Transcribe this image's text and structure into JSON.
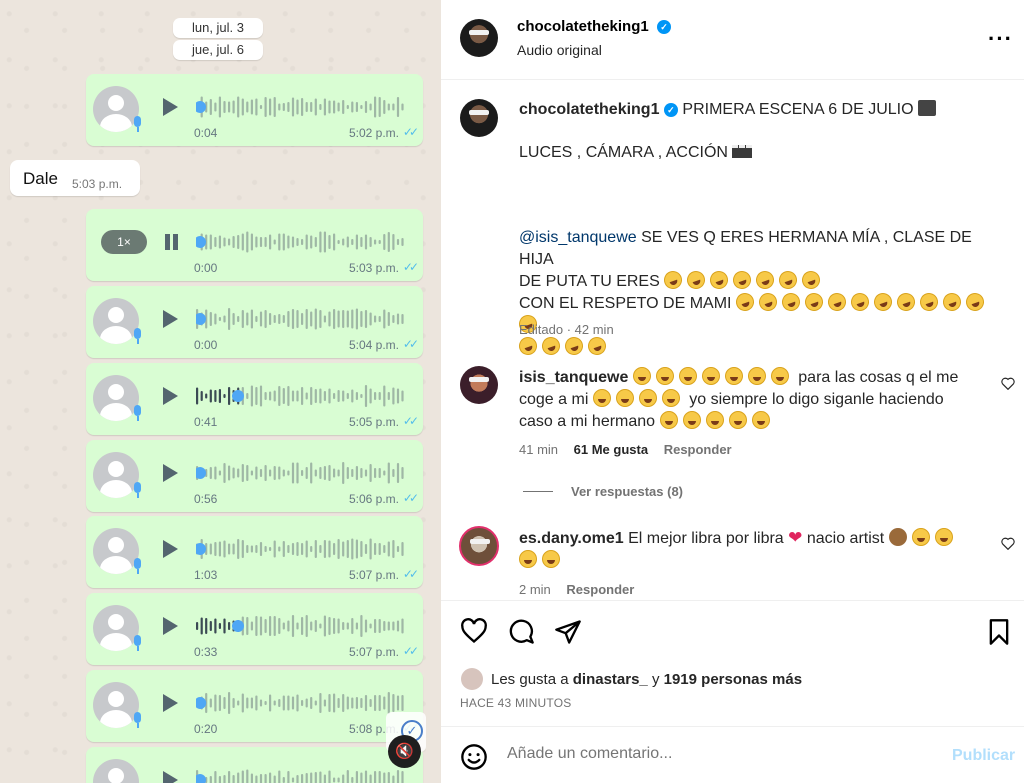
{
  "chat": {
    "dates": [
      "lun, jul. 3",
      "jue, jul. 6"
    ],
    "incoming": {
      "text": "Dale",
      "time": "5:03 p.m."
    },
    "voice_notes": [
      {
        "duration": "0:04",
        "time": "5:02 p.m.",
        "state": "paused",
        "progress": 0.0
      },
      {
        "duration": "0:00",
        "time": "5:03 p.m.",
        "state": "playing",
        "speed": "1×",
        "progress": 0.0
      },
      {
        "duration": "0:00",
        "time": "5:04 p.m.",
        "state": "paused",
        "progress": 0.0
      },
      {
        "duration": "0:41",
        "time": "5:05 p.m.",
        "state": "paused",
        "progress": 0.2
      },
      {
        "duration": "0:56",
        "time": "5:06 p.m.",
        "state": "paused",
        "progress": 0.0
      },
      {
        "duration": "1:03",
        "time": "5:07 p.m.",
        "state": "paused",
        "progress": 0.0
      },
      {
        "duration": "0:33",
        "time": "5:07 p.m.",
        "state": "paused",
        "progress": 0.2
      },
      {
        "duration": "0:20",
        "time": "5:08 p.m.",
        "state": "paused",
        "progress": 0.02
      },
      {
        "duration": "",
        "time": "",
        "state": "paused",
        "progress": 0.0
      }
    ],
    "read_ticks": "✓✓",
    "check_icon": "check-circle-icon",
    "mute_icon": "speaker-muted-icon",
    "colors": {
      "bubble": "#d9fdd3",
      "ticks": "#53bdeb",
      "dot": "#4fa7f5"
    }
  },
  "post": {
    "author": "chocolatetheking1",
    "audio": "Audio original",
    "more_icon": "more-icon",
    "caption": {
      "line1": "PRIMERA ESCENA 6 DE JULIO",
      "line2": "LUCES , CÁMARA , ACCIÓN",
      "mention": "@isis_tanquewe",
      "line3": " SE VES Q ERES HERMANA MÍA , CLASE DE HIJA",
      "line4": "DE PUTA TU ERES",
      "line5": "CON EL RESPETO DE MAMI",
      "edited": "Editado",
      "edited_sep": " · ",
      "edited_time": "42 min"
    },
    "comments": [
      {
        "user": "isis_tanquewe",
        "text_a": "para las cosas q el me",
        "text_b": "coge a mi",
        "text_c": "yo siempre lo digo siganle haciendo",
        "text_d": "caso a mi hermano",
        "time": "41 min",
        "likes": "61 Me gusta",
        "reply": "Responder",
        "view_replies": "Ver respuestas (8)"
      },
      {
        "user": "es.dany.ome1",
        "text_a": "El mejor libra por libra",
        "text_b": "nacio artist",
        "time": "2 min",
        "reply": "Responder"
      }
    ],
    "actions": {
      "like_icon": "heart-icon",
      "comment_icon": "comment-icon",
      "share_icon": "share-icon",
      "save_icon": "bookmark-icon"
    },
    "likes": {
      "prefix": "Les gusta a",
      "user": "dinastars_",
      "mid": "y",
      "others": "1919 personas más"
    },
    "posted": "HACE 43 MINUTOS",
    "comment_box": {
      "emoji_icon": "emoji-icon",
      "placeholder": "Añade un comentario...",
      "publish": "Publicar"
    }
  }
}
